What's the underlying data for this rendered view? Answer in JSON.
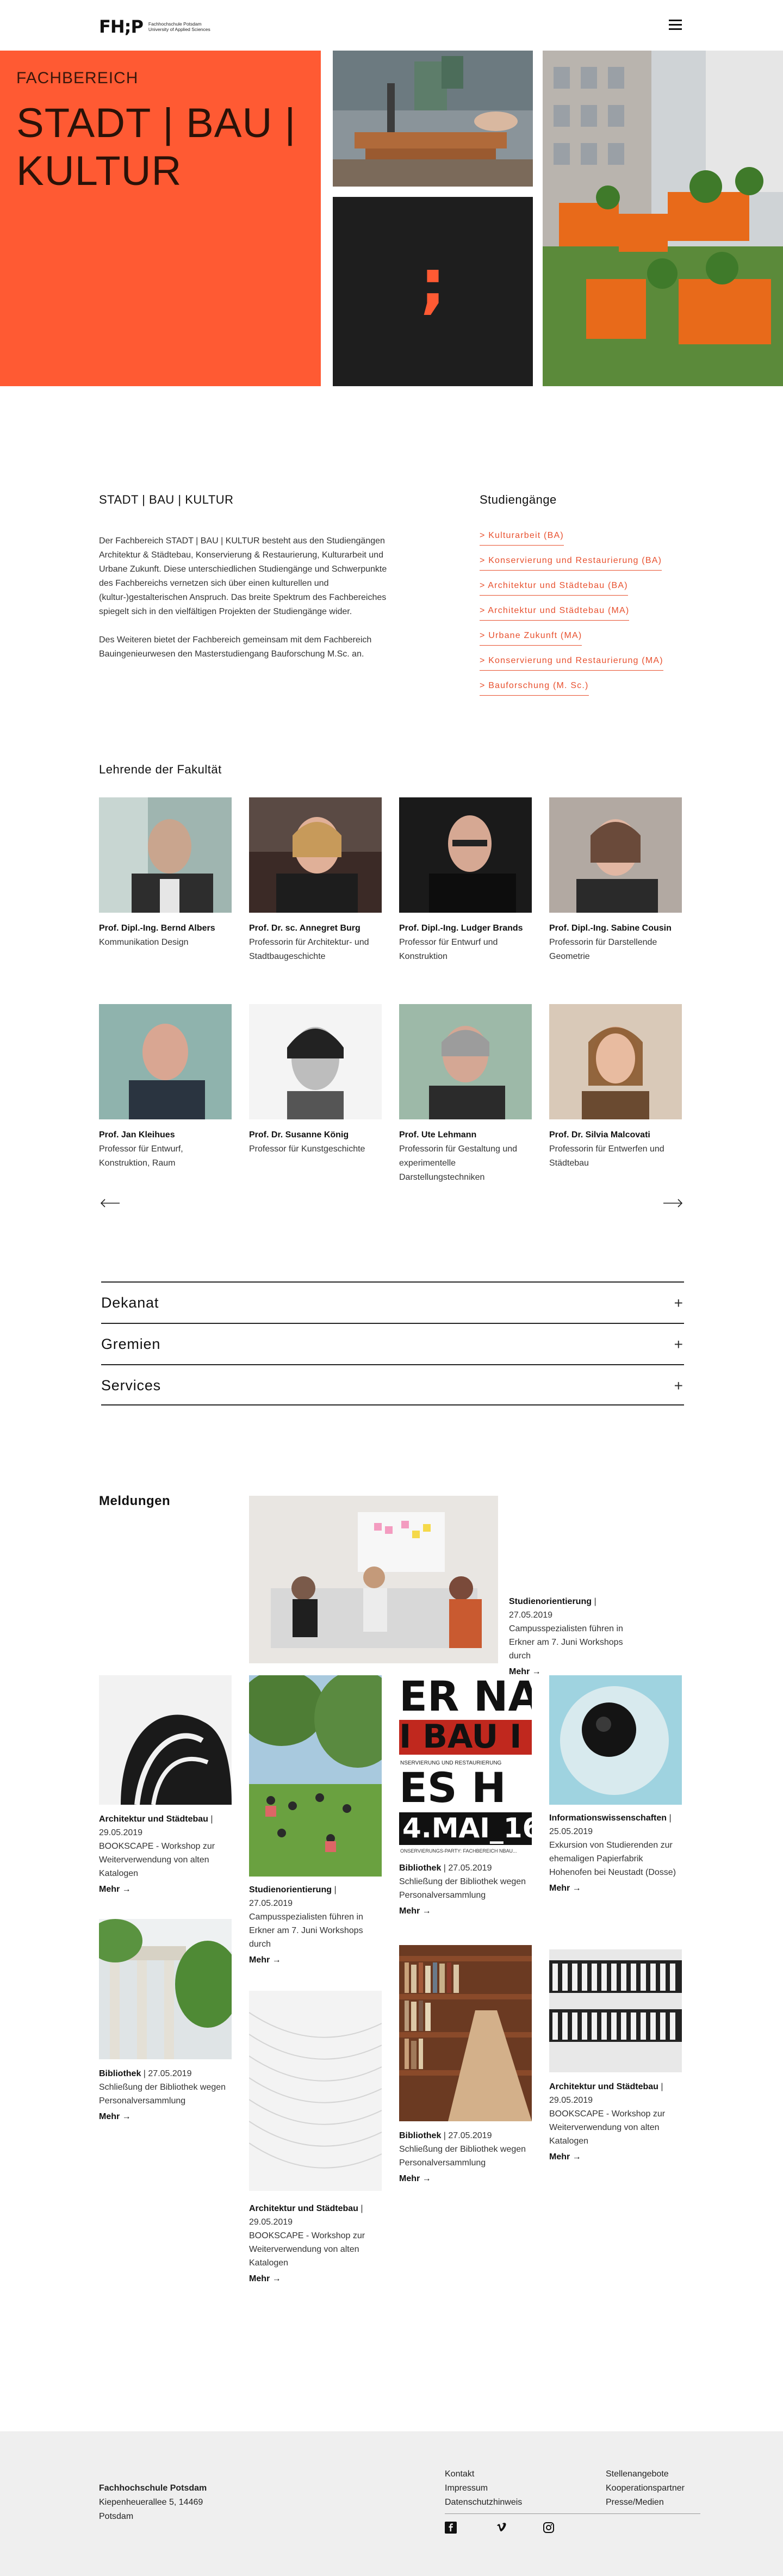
{
  "header": {
    "logo_mark": "FH;P",
    "logo_text": "Fachhochschule Potsdam University of Applied Sciences"
  },
  "hero": {
    "kicker": "FACHBEREICH",
    "title": "STADT | BAU | KULTUR",
    "semicolon": ";"
  },
  "intro": {
    "heading": "STADT | BAU | KULTUR",
    "paragraph1": "Der Fachbereich STADT | BAU | KULTUR besteht aus den Studiengängen Architektur & Städtebau, Konservierung & Restaurierung, Kulturarbeit und Urbane Zukunft. Diese unterschiedlichen Studiengänge und Schwerpunkte des Fachbereichs vernetzen sich über einen kulturellen und (kultur-)gestalterischen Anspruch. Das breite Spektrum des Fachbereiches spiegelt sich in den vielfältigen Projekten der Studiengänge wider.",
    "paragraph2": "Des Weiteren bietet der Fachbereich gemeinsam mit dem Fachbereich Bauingenieurwesen den Masterstudiengang Bauforschung M.Sc. an."
  },
  "studies": {
    "heading": "Studiengänge",
    "items": [
      "> Kulturarbeit (BA)",
      "> Konservierung und Restaurierung (BA)",
      "> Architektur und Städtebau (BA)",
      "> Architektur und Städtebau (MA)",
      "> Urbane Zukunft (MA)",
      "> Konservierung und Restaurierung (MA)",
      "> Bauforschung (M. Sc.)"
    ]
  },
  "faculty": {
    "heading": "Lehrende der Fakultät",
    "people": [
      {
        "name": "Prof. Dipl.-Ing. Bernd Albers",
        "role": "Kommunikation Design"
      },
      {
        "name": "Prof. Dr. sc. Annegret Burg",
        "role": "Professorin für Architektur- und Stadtbaugeschichte"
      },
      {
        "name": "Prof. Dipl.-Ing. Ludger Brands",
        "role": "Professor für Entwurf und Konstruktion"
      },
      {
        "name": "Prof. Dipl.-Ing. Sabine Cousin",
        "role": "Professorin für Darstellende Geometrie"
      },
      {
        "name": "Prof. Jan Kleihues",
        "role": "Professor für Entwurf, Konstruktion, Raum"
      },
      {
        "name": "Prof. Dr. Susanne König",
        "role": "Professor für Kunstgeschichte"
      },
      {
        "name": "Prof. Ute Lehmann",
        "role": "Professorin für Gestaltung und experimentelle Darstellungstechniken"
      },
      {
        "name": "Prof. Dr. Silvia Malcovati",
        "role": "Professorin für Entwerfen und Städtebau"
      }
    ]
  },
  "accordion": {
    "items": [
      "Dekanat",
      "Gremien",
      "Services"
    ],
    "plus": "+"
  },
  "news": {
    "heading": "Meldungen",
    "more_label": "Mehr",
    "poster_lines": [
      "ER NA",
      "I BAU I",
      "NSERVIERUNG UND RESTAURIERUNG",
      "ES H",
      "4.MAI_16",
      "ONSERVIERUNGS-PARTY: FACHBEREICH NBAU..."
    ],
    "items": [
      {
        "category": "Studienorientierung",
        "date": "27.05.2019",
        "text": "Campusspezialisten führen in Erkner am 7. Juni Workshops durch"
      },
      {
        "category": "Architektur und Städtebau",
        "date": "29.05.2019",
        "text": "BOOKSCAPE - Workshop zur Weiterverwendung von alten Katalogen"
      },
      {
        "category": "Studienorientierung",
        "date": "27.05.2019",
        "text": "Campusspezialisten führen in Erkner am 7. Juni Workshops durch"
      },
      {
        "category": "Bibliothek",
        "date": "27.05.2019",
        "text": "Schließung der Bibliothek wegen Personalversammlung"
      },
      {
        "category": "Informationswissenschaften",
        "date": "25.05.2019",
        "text": "Exkursion von Studierenden zur ehemaligen Papierfabrik Hohenofen bei Neustadt (Dosse)"
      },
      {
        "category": "Bibliothek",
        "date": "27.05.2019",
        "text": "Schließung der Bibliothek wegen Personalversammlung"
      },
      {
        "category": "Bibliothek",
        "date": "27.05.2019",
        "text": "Schließung der Bibliothek wegen Personalversammlung"
      },
      {
        "category": "Architektur und Städtebau",
        "date": "29.05.2019",
        "text": "BOOKSCAPE - Workshop zur Weiterverwendung von alten Katalogen"
      },
      {
        "category": "Architektur und Städtebau",
        "date": "29.05.2019",
        "text": "BOOKSCAPE - Workshop zur Weiterverwendung von alten Katalogen"
      }
    ]
  },
  "footer": {
    "name": "Fachhochschule Potsdam",
    "street": "Kiepenheuerallee 5, 14469",
    "city": "Potsdam",
    "links_col1": [
      "Kontakt",
      "Impressum",
      "Datenschutzhinweis"
    ],
    "links_col2": [
      "Stellenangebote",
      "Kooperationspartner",
      "Presse/Medien"
    ]
  },
  "colors": {
    "accent": "#ff5a33",
    "dark": "#1e1e1e",
    "footer_bg": "#efefef"
  }
}
